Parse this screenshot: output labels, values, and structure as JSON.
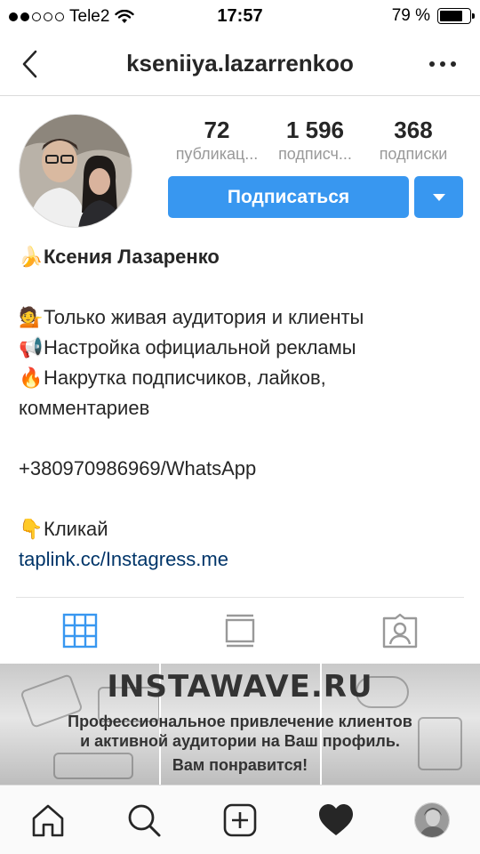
{
  "status_bar": {
    "carrier": "Tele2",
    "time": "17:57",
    "battery_text": "79 %",
    "battery_level": 0.79,
    "signal_bars": 2,
    "signal_total": 5
  },
  "nav": {
    "username": "kseniiya.lazarrenkoo"
  },
  "stats": [
    {
      "number": "72",
      "label": "публикац..."
    },
    {
      "number": "1 596",
      "label": "подписч..."
    },
    {
      "number": "368",
      "label": "подписки"
    }
  ],
  "follow_button": {
    "label": "Подписаться"
  },
  "bio": {
    "name_emoji": "🍌",
    "name": "Ксения Лазаренко",
    "lines": [
      {
        "emoji": "💁",
        "text": "Только живая аудитория и клиенты"
      },
      {
        "emoji": "📢",
        "text": "Настройка официальной рекламы"
      },
      {
        "emoji": "🔥",
        "text": "Накрутка подписчиков, лайков,"
      }
    ],
    "line_cont": "комментариев",
    "phone": "+380970986969/WhatsApp",
    "cta_emoji": "👇",
    "cta": "Кликай",
    "link": "taplink.cc/Instagress.me"
  },
  "tabs": [
    {
      "icon": "grid-icon",
      "active": true
    },
    {
      "icon": "feed-icon",
      "active": false
    },
    {
      "icon": "tagged-icon",
      "active": false
    }
  ],
  "banner": {
    "title": "INSTAWAVE.RU",
    "sub_line1": "Профессиональное привлечение клиентов",
    "sub_line2": "и активной аудитории на Ваш профиль.",
    "tagline": "Вам понравится!"
  },
  "bottom_nav": [
    "home-icon",
    "search-icon",
    "add-post-icon",
    "activity-heart-icon",
    "profile-avatar"
  ],
  "colors": {
    "accent": "#3897f0",
    "link": "#003569",
    "text": "#262626",
    "muted": "#999999"
  }
}
